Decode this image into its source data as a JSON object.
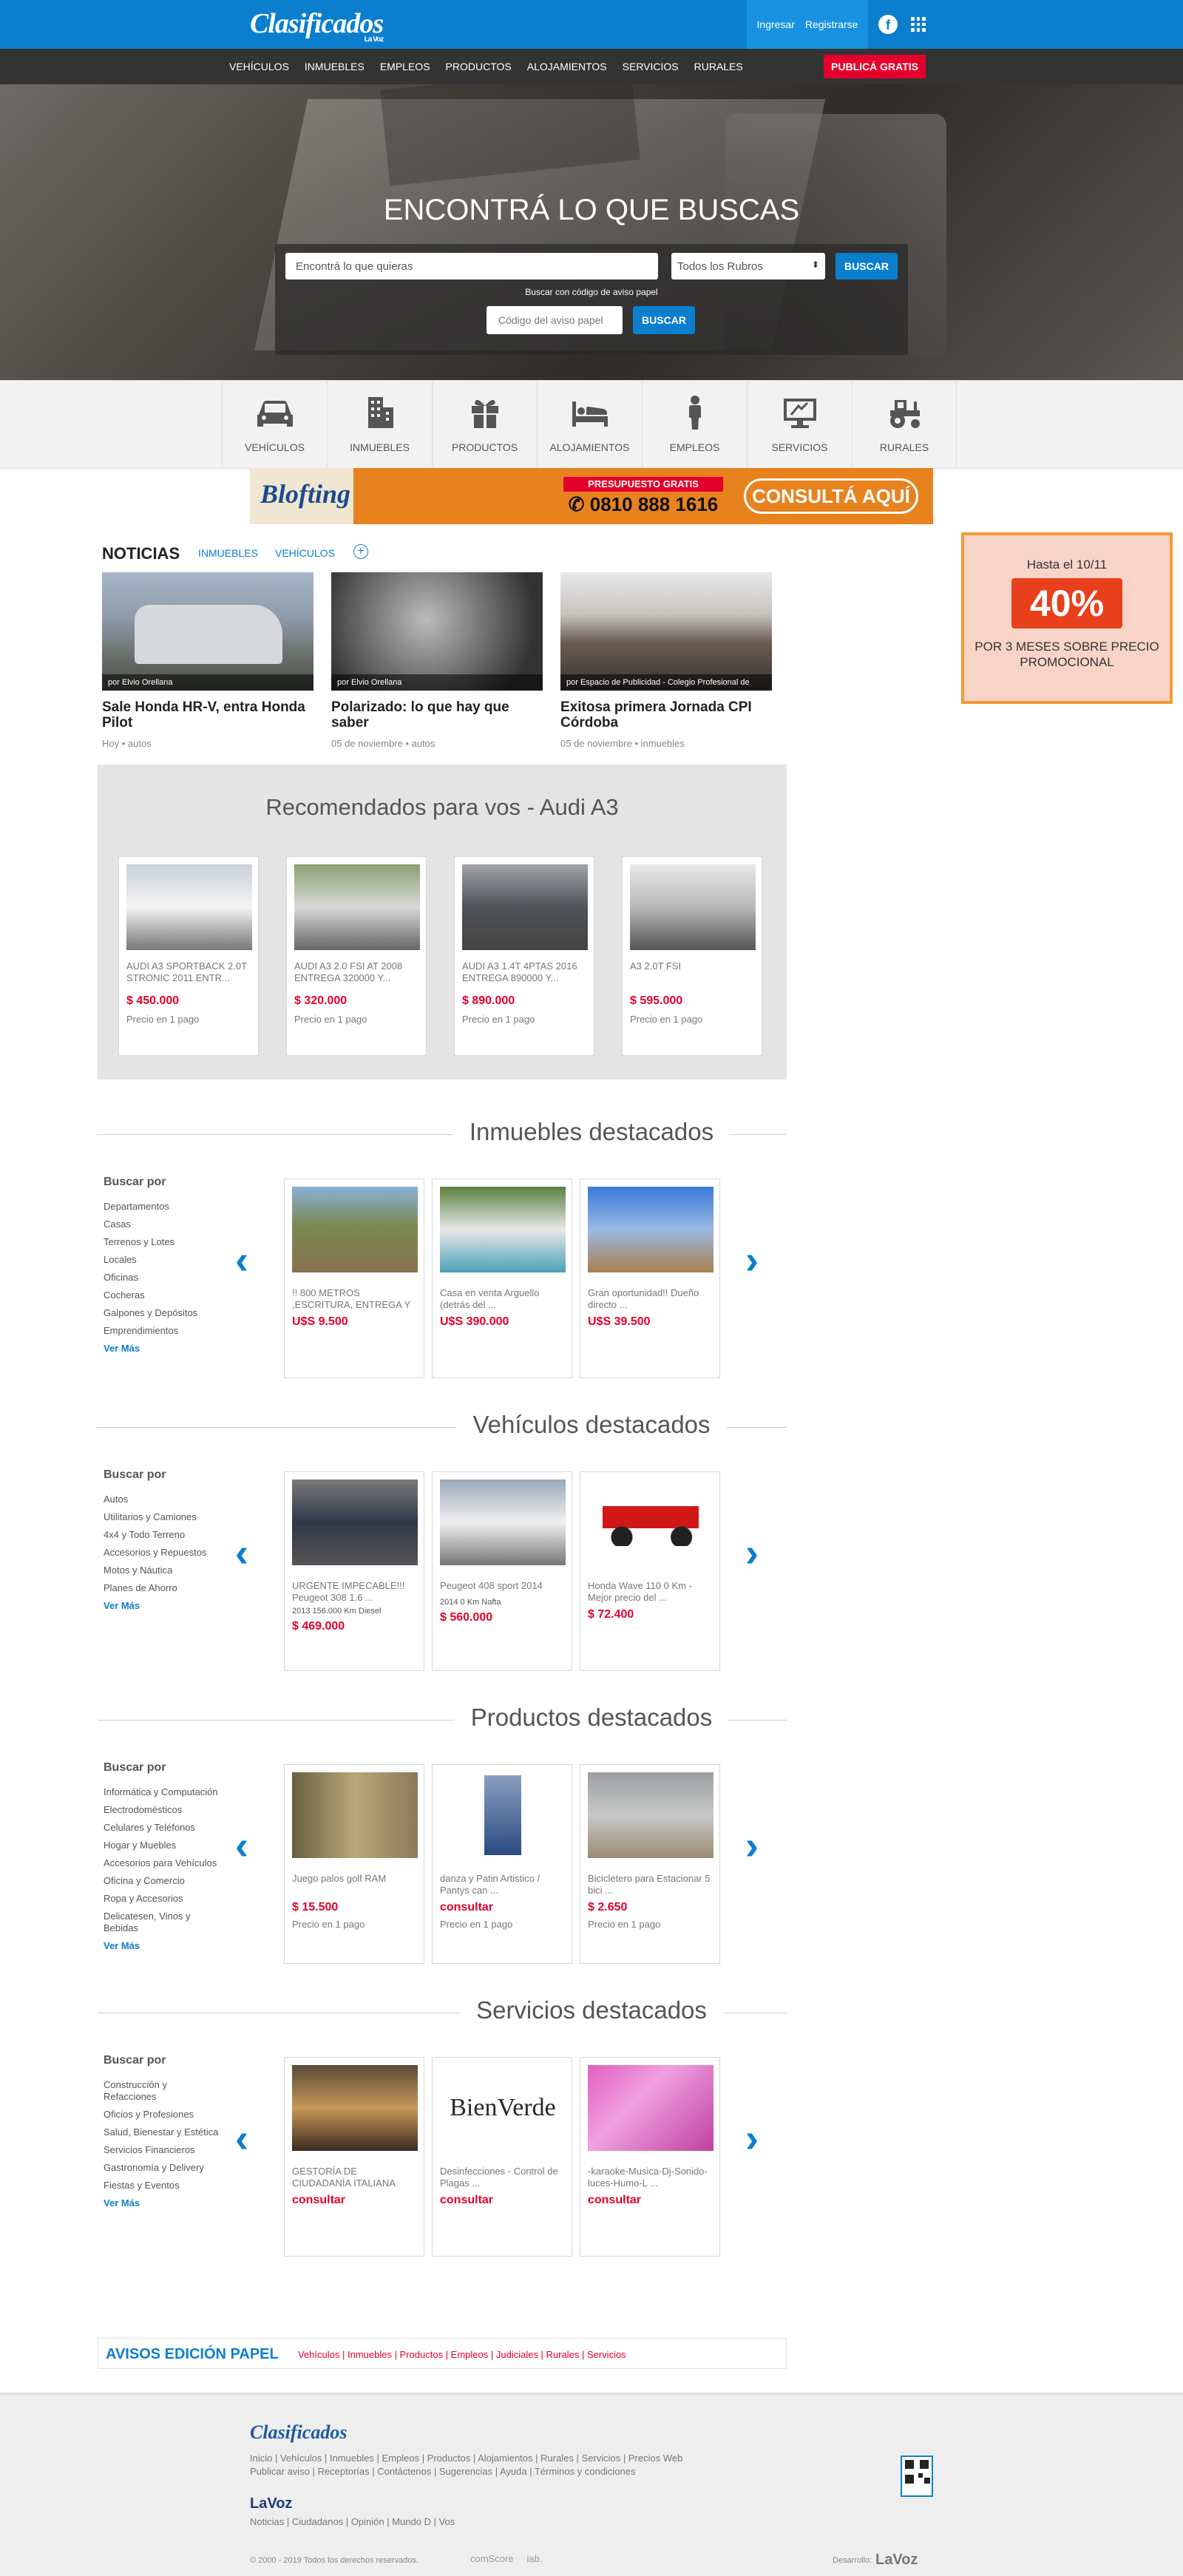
{
  "header": {
    "logo": "Clasificados",
    "logo_sub": "La Voz",
    "login": "Ingresar",
    "register": "Registrarse",
    "fb_icon": "f"
  },
  "nav": {
    "items": [
      "VEHÍCULOS",
      "INMUEBLES",
      "EMPLEOS",
      "PRODUCTOS",
      "ALOJAMIENTOS",
      "SERVICIOS",
      "RURALES"
    ],
    "cta": "PUBLICÁ GRATIS"
  },
  "hero": {
    "title": "ENCONTRÁ LO QUE BUSCAS",
    "search_placeholder": "Encontrá lo que quieras",
    "category_select": "Todos los Rubros",
    "search_button": "BUSCAR",
    "code_label": "Buscar con código de aviso papel",
    "code_placeholder": "Código del aviso papel",
    "code_button": "BUSCAR"
  },
  "categories": [
    "VEHÍCULOS",
    "INMUEBLES",
    "PRODUCTOS",
    "ALOJAMIENTOS",
    "EMPLEOS",
    "SERVICIOS",
    "RURALES"
  ],
  "banner": {
    "brand": "Blofting",
    "top": "PRESUPUESTO GRATIS",
    "phone": "0810 888 1616",
    "cta": "CONSULTÁ AQUÍ"
  },
  "news": {
    "title": "NOTICIAS",
    "tabs": [
      "INMUEBLES",
      "VEHÍCULOS"
    ],
    "plus": "+",
    "items": [
      {
        "credit": "por Elvio Orellana",
        "title": "Sale Honda HR-V, entra Honda Pilot",
        "meta": "Hoy • autos"
      },
      {
        "credit": "por Elvio Orellana",
        "title": "Polarizado: lo que hay que saber",
        "meta": "05 de noviembre • autos"
      },
      {
        "credit": "por Espacio de Publicidad - Colegio Profesional de",
        "title": "Exitosa primera Jornada CPI Córdoba",
        "meta": "05 de noviembre • inmuebles"
      }
    ]
  },
  "promo": {
    "head": "Hasta el 10/11",
    "pct": "40%",
    "desc": "POR 3 MESES SOBRE PRECIO PROMOCIONAL"
  },
  "recommended": {
    "title": "Recomendados para vos - Audi A3",
    "items": [
      {
        "name": "AUDI A3 SPORTBACK 2.0T STRONIC 2011 ENTR...",
        "price": "$ 450.000",
        "sub": "Precio en 1 pago"
      },
      {
        "name": "AUDI A3 2.0 FSI AT 2008 ENTREGA 320000 Y...",
        "price": "$ 320.000",
        "sub": "Precio en 1 pago"
      },
      {
        "name": "AUDI A3 1.4T 4PTAS 2016 ENTREGA 890000 Y...",
        "price": "$ 890.000",
        "sub": "Precio en 1 pago"
      },
      {
        "name": "A3 2.0T FSI",
        "price": "$ 595.000",
        "sub": "Precio en 1 pago"
      }
    ]
  },
  "sections": [
    {
      "title": "Inmuebles destacados",
      "buscar": "Buscar por",
      "links": [
        "Departamentos",
        "Casas",
        "Terrenos y Lotes",
        "Locales",
        "Oficinas",
        "Cocheras",
        "Galpones y Depósitos",
        "Emprendimientos"
      ],
      "more": "Ver Más",
      "items": [
        {
          "name": "!! 800 METROS ,ESCRITURA, ENTREGA Y ...",
          "price": "U$S 9.500"
        },
        {
          "name": "Casa en venta Arguello (detrás del ...",
          "price": "U$S 390.000"
        },
        {
          "name": "Gran oportunidad!! Dueño directo ...",
          "price": "U$S 39.500"
        }
      ]
    },
    {
      "title": "Vehículos destacados",
      "buscar": "Buscar por",
      "links": [
        "Autos",
        "Utilitarios y Camiones",
        "4x4 y Todo Terreno",
        "Accesorios y Repuestos",
        "Motos y Náutica",
        "Planes de Ahorro"
      ],
      "more": "Ver Más",
      "items": [
        {
          "name": "URGENTE IMPECABLE!!! Peugeot 308 1.6 ...",
          "extra": "2013 156.000 Km Diesel",
          "price": "$ 469.000"
        },
        {
          "name": "Peugeot 408 sport 2014",
          "extra": "2014 0 Km Nafta",
          "price": "$ 560.000"
        },
        {
          "name": "Honda Wave 110 0 Km - Mejor precio del ...",
          "price": "$ 72.400"
        }
      ]
    },
    {
      "title": "Productos destacados",
      "buscar": "Buscar por",
      "links": [
        "Informática y Computación",
        "Electrodomésticos",
        "Celulares y Teléfonos",
        "Hogar y Muebles",
        "Accesorios para Vehículos",
        "Oficina y Comercio",
        "Ropa y Accesorios",
        "Delicatesen, Vinos y Bebidas"
      ],
      "more": "Ver Más",
      "items": [
        {
          "name": "Juego palos golf RAM",
          "price": "$ 15.500",
          "sub": "Precio en 1 pago"
        },
        {
          "name": "danza y Patin Artistico / Pantys can ...",
          "price": "consultar",
          "sub": "Precio en 1 pago"
        },
        {
          "name": "Bicicletero para Estacionar 5 bici ...",
          "price": "$ 2.650",
          "sub": "Precio en 1 pago"
        }
      ]
    },
    {
      "title": "Servicios destacados",
      "buscar": "Buscar por",
      "links": [
        "Construcción y Refacciones",
        "Oficios y Profesiones",
        "Salud, Bienestar y Estética",
        "Servicios Financieros",
        "Gastronomía y Delivery",
        "Fiestas y Eventos"
      ],
      "more": "Ver Más",
      "items": [
        {
          "name": "GESTORÍA DE CIUDADANÍA ITALIANA",
          "price": "consultar"
        },
        {
          "name": "Desinfecciones - Control de Plagas ...",
          "price": "consultar",
          "logo": "BienVerde"
        },
        {
          "name": "-karaoke-Musica-Dj-Sonido-luces-Humo-L ...",
          "price": "consultar"
        }
      ]
    }
  ],
  "aviso": {
    "title": "AVISOS EDICIÓN PAPEL",
    "links": "Vehículos | Inmuebles | Productos | Empleos | Judiciales | Rurales | Servicios"
  },
  "footer": {
    "logo": "Clasificados",
    "links1": "Inicio | Vehículos | Inmuebles | Empleos | Productos | Alojamientos | Rurales | Servicios | Precios Web",
    "links2": "Publicar aviso | Receptorías | Contáctenos | Sugerencias | Ayuda | Términos y condiciones",
    "lavoz": "LaVoz",
    "links3": "Noticias | Ciudadanos | Opinión | Mundo D | Vos",
    "copyright": "© 2000 - 2019 Todos los derechos reservados.",
    "sponsors": [
      "comScore",
      "iab."
    ],
    "dev_label": "Desarrollo:",
    "dev_logo": "LaVoz"
  },
  "colors": {
    "primary": "#0b7fce",
    "accent": "#e4002b",
    "nav": "#333333"
  }
}
